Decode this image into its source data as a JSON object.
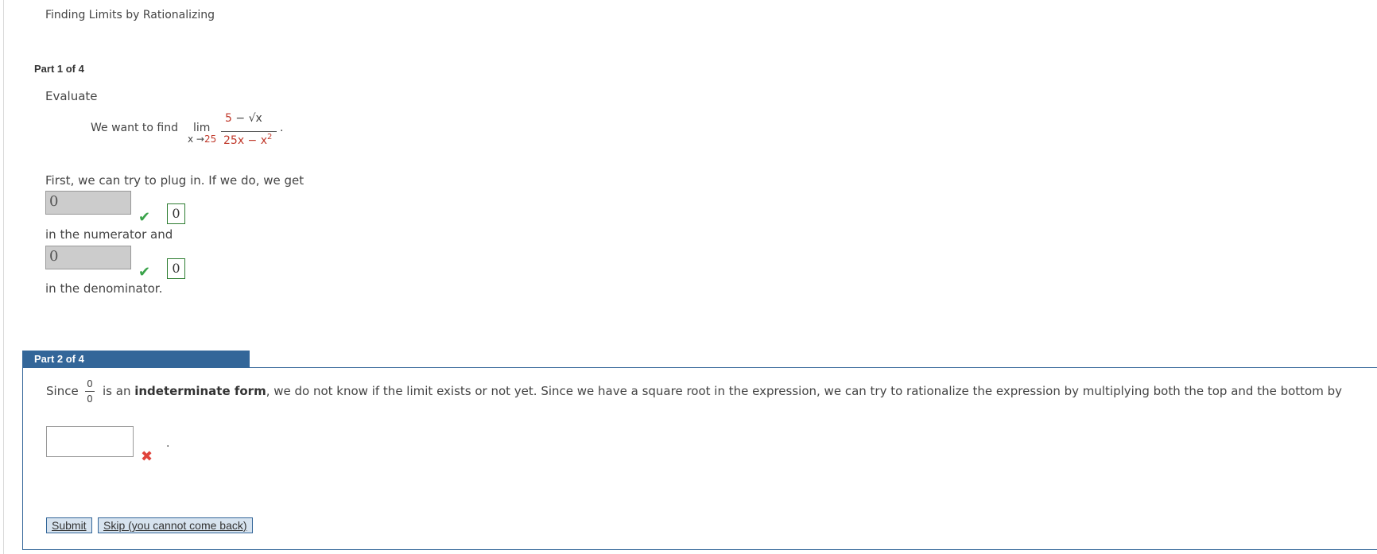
{
  "page": {
    "title": "Finding Limits by Rationalizing"
  },
  "part1": {
    "header": "Part 1 of 4",
    "evaluate": "Evaluate",
    "want_text": "We want to find",
    "lim": "lim",
    "lim_sub_var": "x →",
    "lim_sub_val": "25",
    "numerator_num": "5",
    "numerator_op": "−",
    "numerator_sqrt": "√x",
    "denominator": "25x − x",
    "denominator_exp": "2",
    "period": ".",
    "plug_text": "First, we can try to plug in. If we do, we get",
    "input1_value": "0",
    "answer1": "0",
    "numerator_text": "in the numerator and",
    "input2_value": "0",
    "answer2": "0",
    "denominator_text": "in the denominator."
  },
  "part2": {
    "header": "Part 2 of 4",
    "since": "Since",
    "frac_top": "0",
    "frac_bottom": "0",
    "text_before_bold": "is an",
    "bold": "indeterminate form",
    "text_after_bold": ", we do not know if the limit exists or not yet. Since we have a square root in the expression, we can try to rationalize the expression by multiplying both the top and the bottom by",
    "input_value": "",
    "period": ".",
    "submit_label": "Submit",
    "skip_label": "Skip (you cannot come back)"
  },
  "colors": {
    "accent": "#336699",
    "correct": "#3aa34a",
    "wrong": "#e0433b",
    "highlight": "#c0392b"
  },
  "icons": {
    "correct": "check-icon",
    "wrong": "x-icon"
  }
}
